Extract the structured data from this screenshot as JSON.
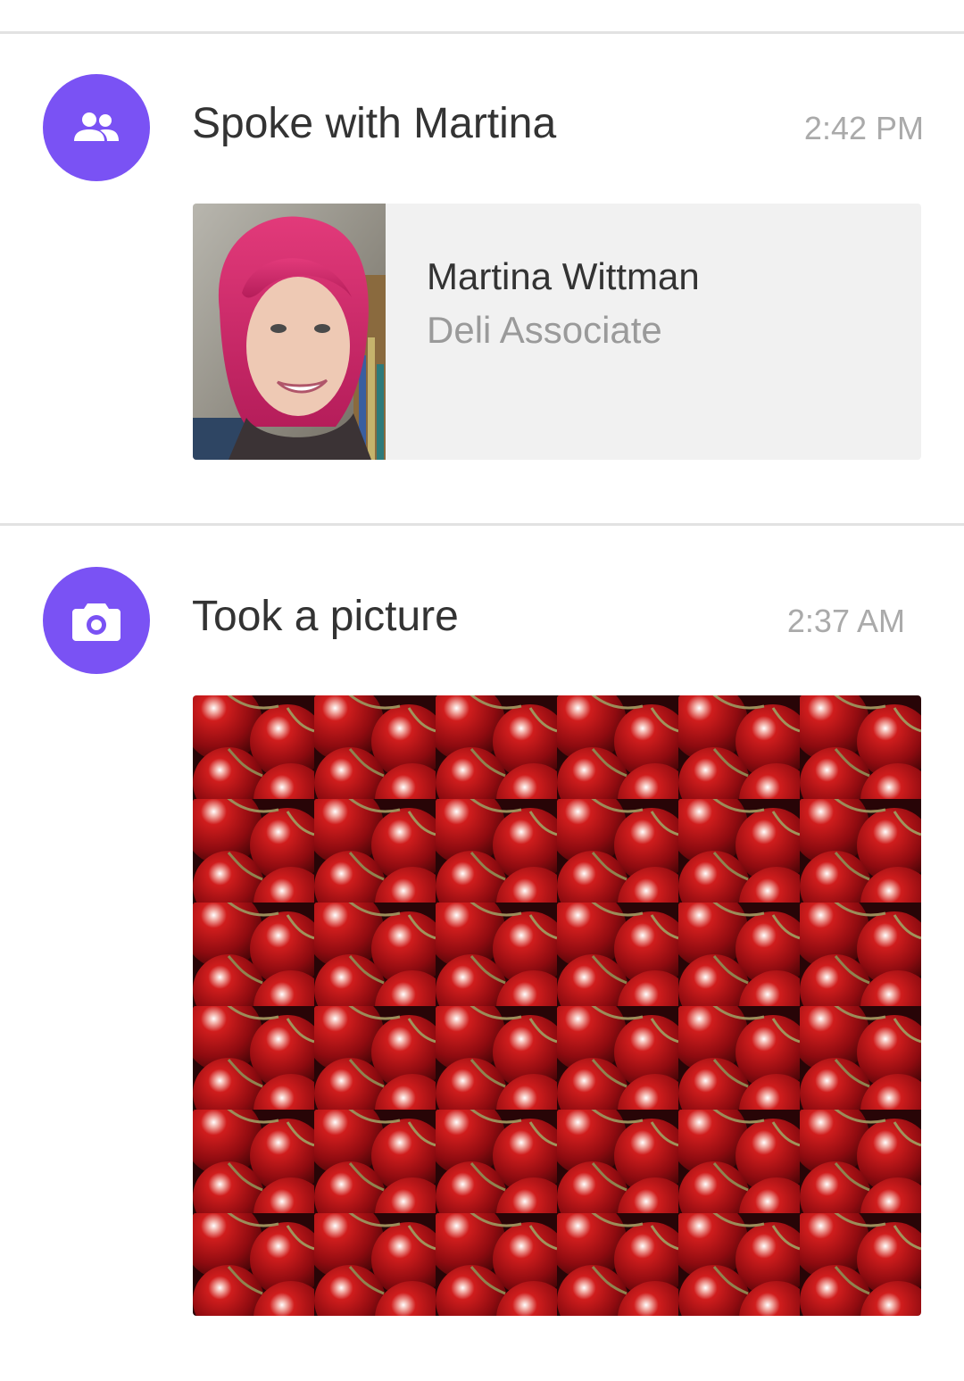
{
  "accent_color": "#7a52f4",
  "timeline": [
    {
      "icon": "people-icon",
      "title": "Spoke with Martina",
      "time": "2:42 PM",
      "contact": {
        "name": "Martina Wittman",
        "role": "Deli Associate"
      }
    },
    {
      "icon": "camera-icon",
      "title": "Took a picture",
      "time": "2:37 AM"
    }
  ]
}
